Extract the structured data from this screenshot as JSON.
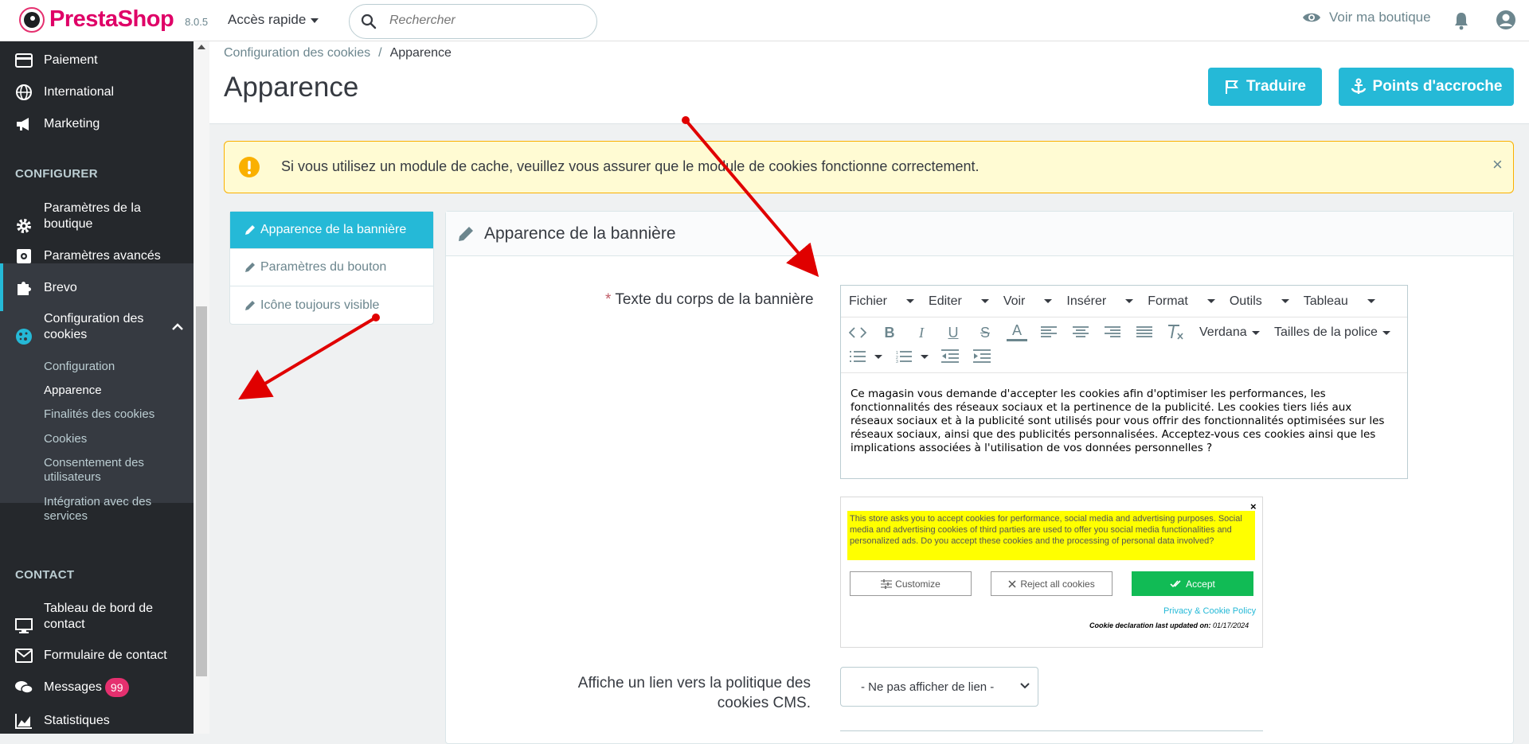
{
  "header": {
    "logo": "PrestaShop",
    "version": "8.0.5",
    "quick_access": "Accès rapide",
    "search_placeholder": "Rechercher",
    "view_shop": "Voir ma boutique"
  },
  "sidebar": {
    "items_top": [
      {
        "label": "Paiement",
        "icon": "credit-card-icon"
      },
      {
        "label": "International",
        "icon": "globe-icon"
      },
      {
        "label": "Marketing",
        "icon": "megaphone-icon"
      }
    ],
    "section_configurer": "CONFIGURER",
    "items_config": [
      {
        "label": "Paramètres de la boutique",
        "icon": "gear-icon"
      },
      {
        "label": "Paramètres avancés",
        "icon": "settings-box-icon"
      },
      {
        "label": "Brevo",
        "icon": "puzzle-icon"
      },
      {
        "label": "Configuration des cookies",
        "icon": "cookie-icon"
      }
    ],
    "submenu": [
      "Configuration",
      "Apparence",
      "Finalités des cookies",
      "Cookies",
      "Consentement des utilisateurs",
      "Intégration avec des services"
    ],
    "section_contact": "CONTACT",
    "items_contact": [
      {
        "label": "Tableau de bord de contact",
        "icon": "monitor-icon"
      },
      {
        "label": "Formulaire de contact",
        "icon": "mail-icon"
      },
      {
        "label": "Messages",
        "icon": "chat-icon",
        "badge": "99"
      },
      {
        "label": "Statistiques",
        "icon": "chart-icon"
      }
    ]
  },
  "page": {
    "breadcrumb": [
      "Configuration des cookies",
      "Apparence"
    ],
    "breadcrumb_sep": "/",
    "title": "Apparence",
    "btn_translate": "Traduire",
    "btn_hooks": "Points d'accroche"
  },
  "alert": {
    "text": "Si vous utilisez un module de cache, veuillez vous assurer que le module de cookies fonctionne correctement.",
    "close": "×"
  },
  "tabs": [
    "Apparence de la bannière",
    "Paramètres du bouton",
    "Icône toujours visible"
  ],
  "panel": {
    "title": "Apparence de la bannière",
    "field_label_star": "*",
    "field_label": "Texte du corps de la bannière",
    "editor_menu": [
      "Fichier",
      "Editer",
      "Voir",
      "Insérer",
      "Format",
      "Outils",
      "Tableau"
    ],
    "font_family": "Verdana",
    "font_size": "Tailles de la police",
    "editor_text": "Ce magasin vous demande d'accepter les cookies afin d'optimiser les performances, les fonctionnalités des réseaux sociaux et la pertinence de la publicité. Les cookies tiers liés aux réseaux sociaux et à la publicité sont utilisés pour vous offrir des fonctionnalités optimisées sur les réseaux sociaux, ainsi que des publicités personnalisées. Acceptez-vous ces cookies ainsi que les implications associées à l'utilisation de vos données personnelles ?",
    "preview": {
      "close": "×",
      "text": "This store asks you to accept cookies for performance, social media and advertising purposes. Social media and advertising cookies of third parties are used to offer you social media functionalities and personalized ads. Do you accept these cookies and the processing of personal data involved?",
      "customize": "Customize",
      "reject": "Reject all cookies",
      "accept": "Accept",
      "privacy": "Privacy & Cookie Policy",
      "declaration_label": "Cookie declaration last updated on:",
      "declaration_date": "01/17/2024"
    },
    "field2_label": "Affiche un lien vers la politique des cookies CMS.",
    "field2_value": "- Ne pas afficher de lien -"
  },
  "colors": {
    "accent": "#25b9d7",
    "sidebar_bg": "#25282c",
    "alert_bg": "#fffbd3",
    "arrow": "#e00000"
  }
}
